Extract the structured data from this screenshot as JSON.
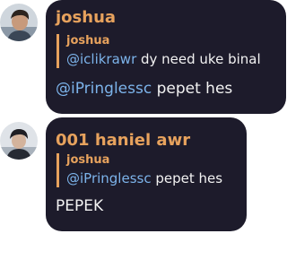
{
  "messages": [
    {
      "author": "joshua",
      "reply": {
        "author": "joshua",
        "mention": "@iclikrawr",
        "text": " dy need uke binal"
      },
      "body": {
        "mention": "@iPringlessc",
        "text": " pepet hes"
      }
    },
    {
      "author": "001 haniel awr",
      "reply": {
        "author": "joshua",
        "mention": "@iPringlessc",
        "text": " pepet hes"
      },
      "body": {
        "text": "PEPEK"
      }
    }
  ],
  "colors": {
    "bubble": "#1d1b2b",
    "author": "#e7a25d",
    "mention": "#7cb3ea",
    "text": "#f2f2f2"
  }
}
